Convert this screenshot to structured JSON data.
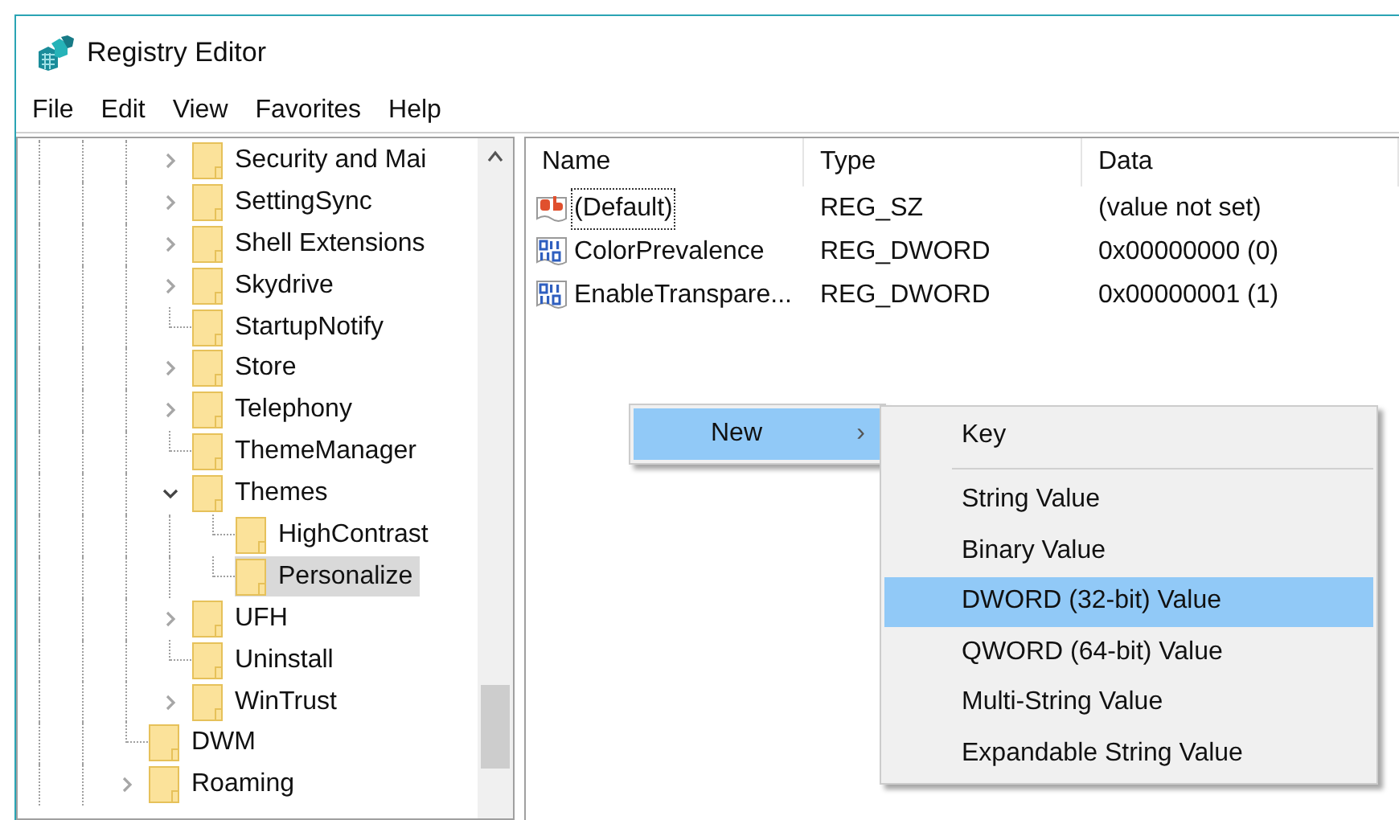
{
  "window": {
    "title": "Registry Editor"
  },
  "menu_bar": [
    "File",
    "Edit",
    "View",
    "Favorites",
    "Help"
  ],
  "tree": [
    {
      "children": [
        {
          "label": "Security and Mai",
          "expanded": false,
          "selected": false
        },
        {
          "label": "SettingSync",
          "expanded": false,
          "selected": false
        },
        {
          "label": "Shell Extensions",
          "expanded": false,
          "selected": false
        },
        {
          "label": "Skydrive",
          "expanded": false,
          "selected": false
        },
        {
          "label": "StartupNotify",
          "selected": false
        },
        {
          "label": "Store",
          "expanded": false,
          "selected": false
        },
        {
          "label": "Telephony",
          "expanded": false,
          "selected": false
        },
        {
          "label": "ThemeManager",
          "selected": false
        },
        {
          "label": "Themes",
          "expanded": true,
          "selected": false,
          "children": [
            {
              "label": "HighContrast",
              "selected": false
            },
            {
              "label": "Personalize",
              "selected": true
            }
          ]
        },
        {
          "label": "UFH",
          "expanded": false,
          "selected": false
        },
        {
          "label": "Uninstall",
          "selected": false
        },
        {
          "label": "WinTrust",
          "expanded": false,
          "selected": false
        }
      ]
    },
    {
      "label": "DWM",
      "selected": false
    },
    {
      "label": "Roaming",
      "expanded": false,
      "selected": false
    }
  ],
  "table": {
    "columns": [
      "Name",
      "Type",
      "Data"
    ],
    "rows": [
      {
        "kind": "string",
        "name": "(Default)",
        "type": "REG_SZ",
        "data": "(value not set)",
        "focused": true
      },
      {
        "kind": "binary",
        "name": "ColorPrevalence",
        "type": "REG_DWORD",
        "data": "0x00000000 (0)",
        "focused": false
      },
      {
        "kind": "binary",
        "name": "EnableTranspare...",
        "type": "REG_DWORD",
        "data": "0x00000001 (1)",
        "focused": false
      }
    ]
  },
  "context_menu": {
    "items": [
      {
        "label": "New",
        "arrow": "›",
        "selected": true
      }
    ]
  },
  "submenu": {
    "items": [
      {
        "kind": "item",
        "label": "Key",
        "selected": false
      },
      {
        "kind": "separator"
      },
      {
        "kind": "item",
        "label": "String Value",
        "selected": false
      },
      {
        "kind": "item",
        "label": "Binary Value",
        "selected": false
      },
      {
        "kind": "item",
        "label": "DWORD (32-bit) Value",
        "selected": true
      },
      {
        "kind": "item",
        "label": "QWORD (64-bit) Value",
        "selected": false
      },
      {
        "kind": "item",
        "label": "Multi-String Value",
        "selected": false
      },
      {
        "kind": "item",
        "label": "Expandable String Value",
        "selected": false
      }
    ]
  }
}
